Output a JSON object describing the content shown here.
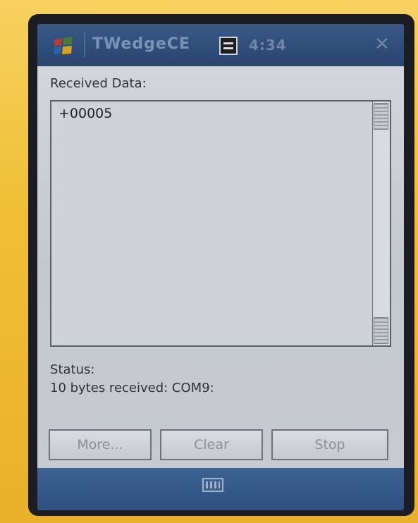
{
  "app": {
    "title": "TWedgeCE",
    "clock": "4:34",
    "close_glyph": "✕"
  },
  "received": {
    "label": "Received Data:",
    "value": "+00005"
  },
  "status": {
    "label": "Status:",
    "message": "10 bytes received: COM9:"
  },
  "buttons": {
    "more": "More...",
    "clear": "Clear",
    "stop": "Stop"
  },
  "icons": {
    "start": "windows-flag-icon",
    "connectivity": "connectivity-icon",
    "keyboard": "keyboard-icon"
  },
  "colors": {
    "titlebar": "#2e4c78",
    "device_body": "#f2c23a"
  }
}
